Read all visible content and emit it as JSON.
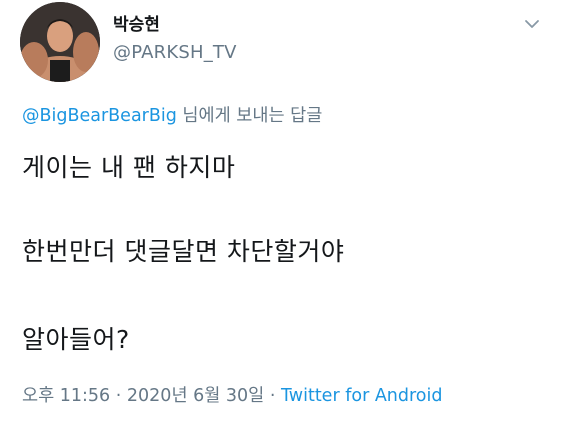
{
  "user": {
    "display_name": "박승현",
    "handle": "@PARKSH_TV"
  },
  "reply": {
    "mention": "@BigBearBearBig",
    "suffix": " 님에게 보내는 답글"
  },
  "tweet": {
    "lines": [
      "게이는 내 팬 하지마",
      "한번만더 댓글달면 차단할거야",
      "알아들어?"
    ]
  },
  "meta": {
    "time": "오후 11:56",
    "separator1": " · ",
    "date": "2020년 6월 30일",
    "separator2": " · ",
    "source": "Twitter for Android"
  },
  "icons": {
    "avatar": "profile-photo",
    "menu": "chevron-down-icon"
  },
  "colors": {
    "link": "#1b95e0",
    "secondary_text": "#657786",
    "primary_text": "#14171a"
  }
}
